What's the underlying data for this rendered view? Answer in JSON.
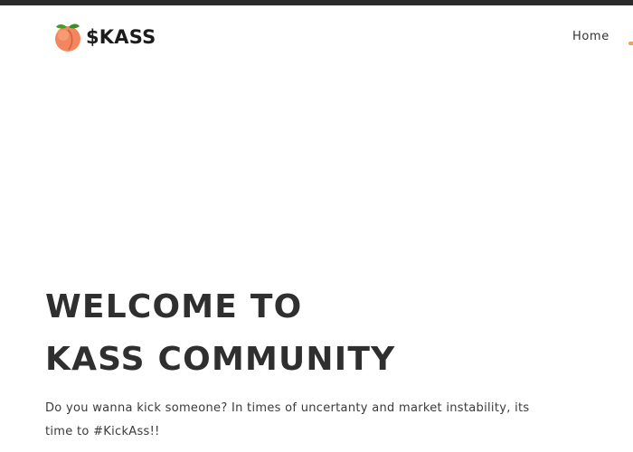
{
  "brand": {
    "logo_icon": "peach-icon",
    "name": "$KASS"
  },
  "nav": {
    "items": [
      {
        "label": "Home"
      }
    ],
    "accent_color": "#f0a25b"
  },
  "hero": {
    "title_line1": "WELCOME TO",
    "title_line2": "KASS COMMUNITY",
    "subtitle": "Do you wanna kick someone? In times of uncertanty and market instability, its time to #KickAss!!"
  },
  "colors": {
    "top_strip": "#2b2b2b",
    "heading": "#2f2f2f",
    "peach": "#f4865f",
    "leaf": "#4a9a2c"
  }
}
